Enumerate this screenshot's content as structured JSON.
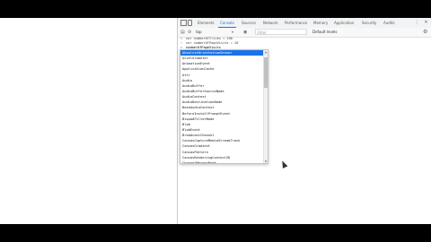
{
  "devtools": {
    "tabs": [
      "Elements",
      "Console",
      "Sources",
      "Network",
      "Performance",
      "Memory",
      "Application",
      "Security",
      "Audits"
    ],
    "active_tab": "Console",
    "console_bar": {
      "context": "top",
      "filter_placeholder": "Filter",
      "levels": "Default levels"
    },
    "console_lines": [
      {
        "prompt": ">",
        "text": "var numberOfClicks = 100"
      },
      {
        "prompt": "<",
        "text": "var numberOfPageVisits = 20"
      },
      {
        "prompt": ">",
        "text": "numberOfPageVisits"
      }
    ],
    "autocomplete": {
      "selected": "AbsoluteOrientationSensor",
      "items": [
        "AbsoluteOrientationSensor",
        "Accelerometer",
        "AnimationEvent",
        "ApplicationCache",
        "Attr",
        "Audio",
        "AudioBuffer",
        "AudioBufferSourceNode",
        "AudioContext",
        "AudioDestinationNode",
        "BaseAudioContext",
        "BeforeInstallPromptEvent",
        "BiquadFilterNode",
        "Blob",
        "BlobEvent",
        "BroadcastChannel",
        "CanvasCaptureMediaStreamTrack",
        "CanvasGradient",
        "CanvasPattern",
        "CanvasRenderingContext2D",
        "ChannelMergerNode",
        "ClipboardEvent",
        "CloseEvent",
        "CompositionEvent",
        "ConvolverNode"
      ]
    }
  }
}
